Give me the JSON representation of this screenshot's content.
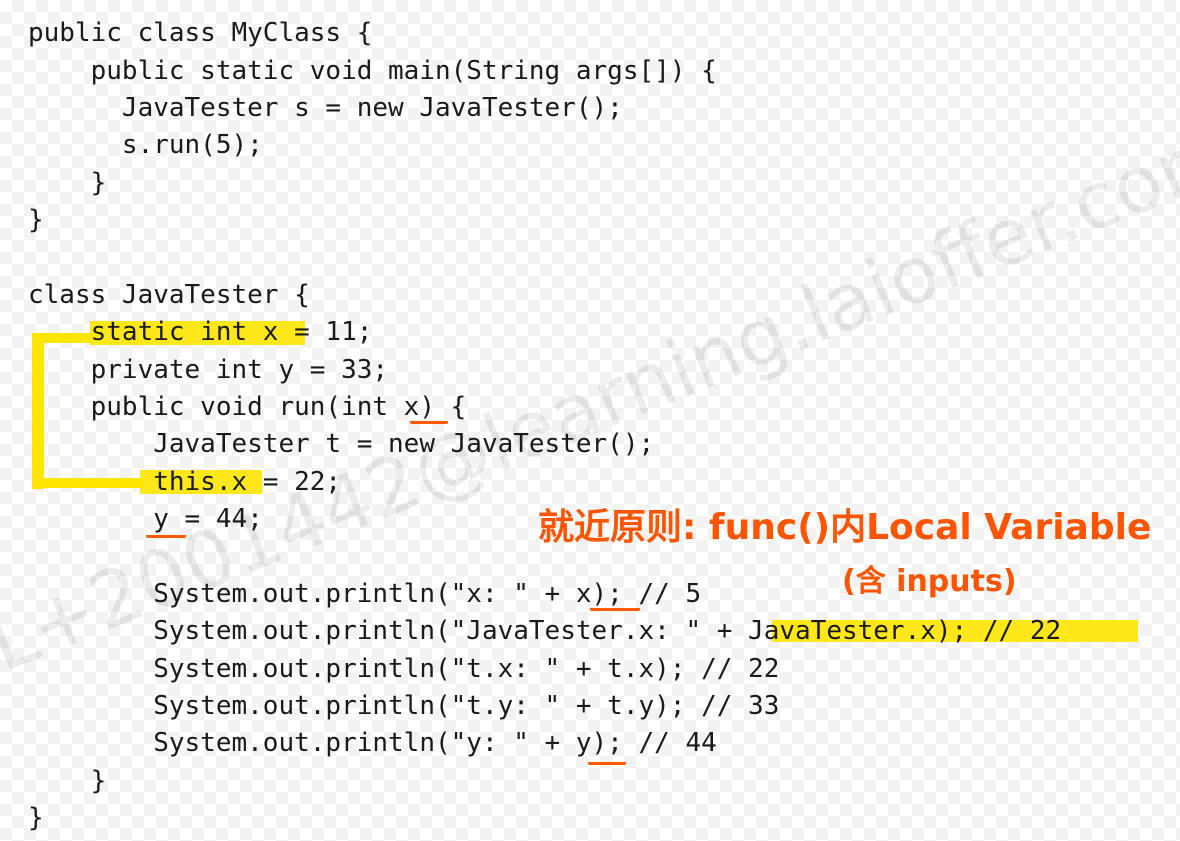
{
  "code_lines": [
    "public class MyClass {",
    "    public static void main(String args[]) {",
    "      JavaTester s = new JavaTester();",
    "      s.run(5);",
    "    }",
    "}",
    "",
    "class JavaTester {",
    "    static int x = 11;",
    "    private int y = 33;",
    "    public void run(int x) {",
    "        JavaTester t = new JavaTester();",
    "        this.x = 22;",
    "        y = 44;",
    "",
    "        System.out.println(\"x: \" + x); // 5",
    "        System.out.println(\"JavaTester.x: \" + JavaTester.x); // 22",
    "        System.out.println(\"t.x: \" + t.x); // 22",
    "        System.out.println(\"t.y: \" + t.y); // 33",
    "        System.out.println(\"y: \" + y); // 44",
    "    }",
    "}"
  ],
  "annotations": {
    "principle": "就近原则: func()内Local Variable",
    "inputs_note": "(含 inputs)"
  },
  "watermark": "L+2001442@learning.laioffer.com",
  "colors": {
    "highlight": "#ffe600",
    "ink": "#ff5500",
    "code": "#1a1a1a"
  }
}
